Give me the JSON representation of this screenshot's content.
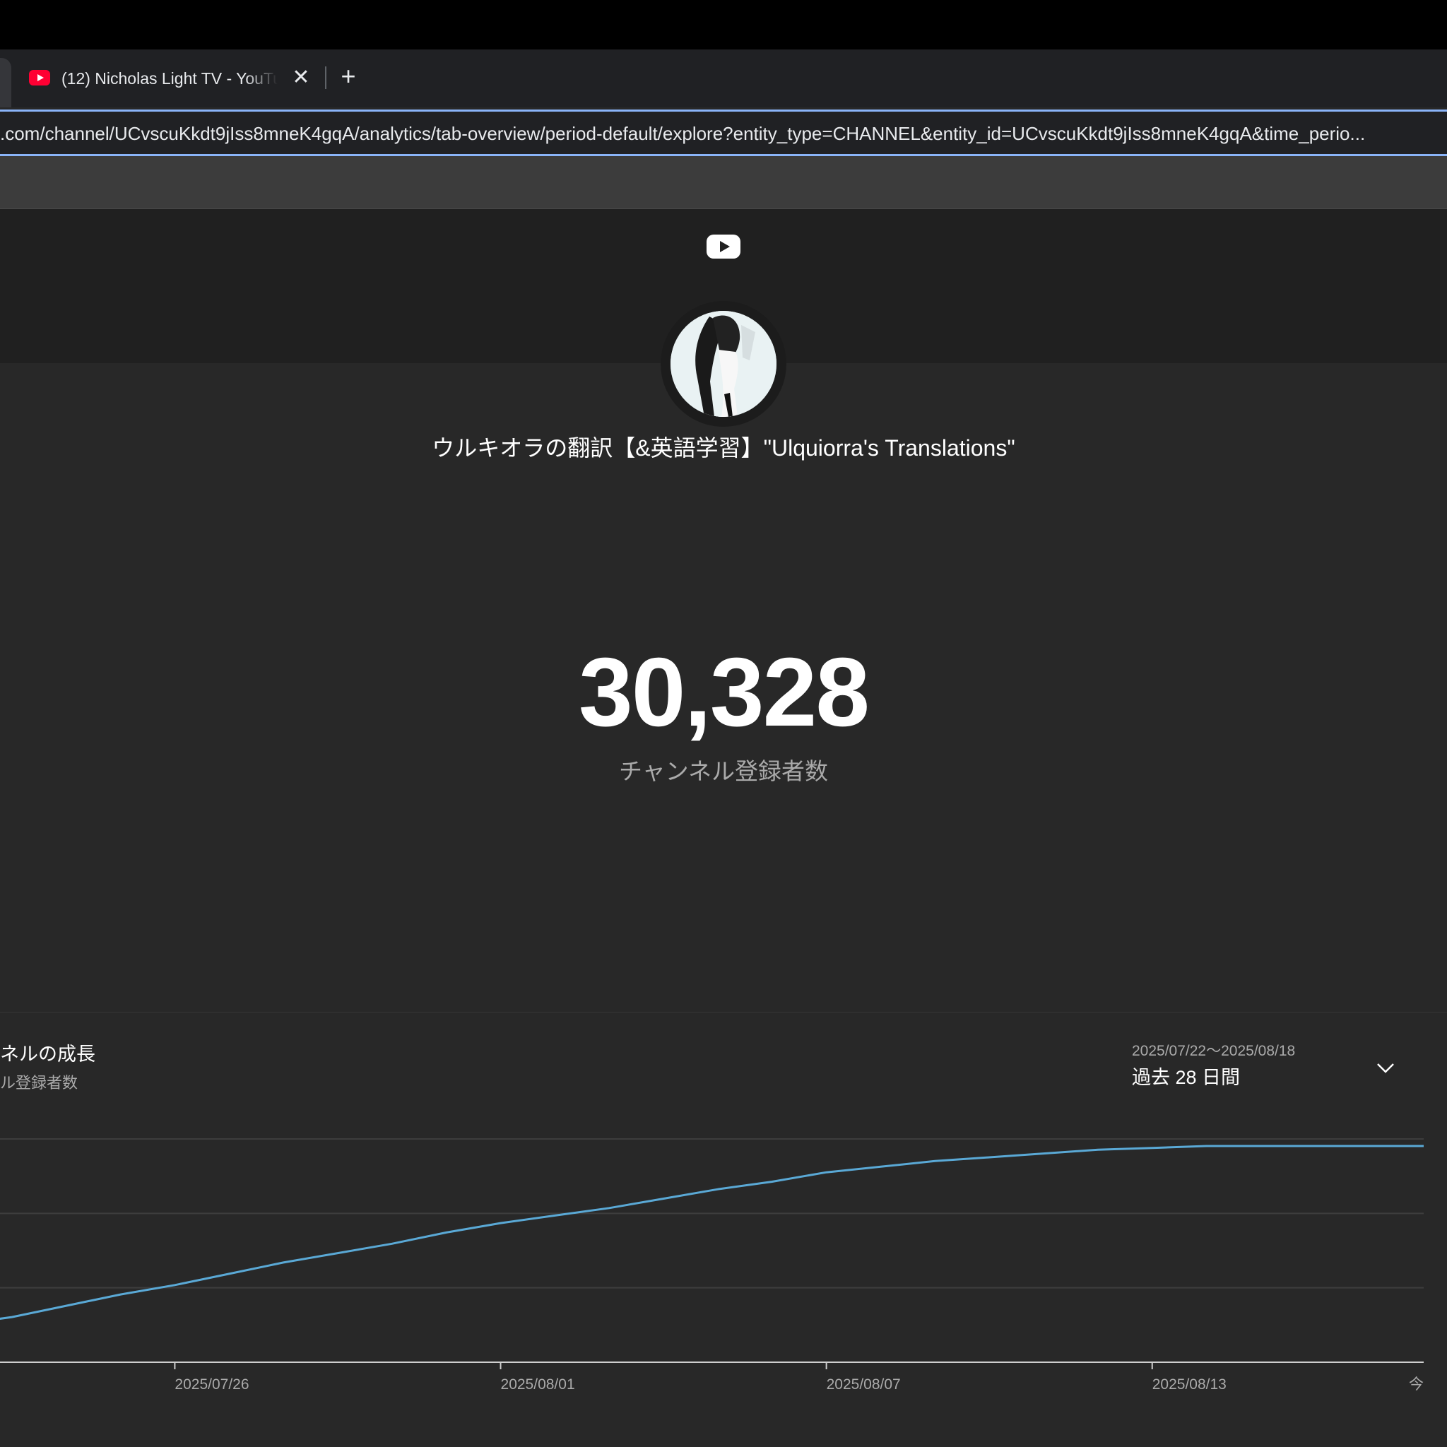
{
  "browser": {
    "tab_title": "(12) Nicholas Light TV - YouTube",
    "close_glyph": "✕",
    "new_tab_glyph": "+",
    "url": ".com/channel/UCvscuKkdt9jIss8mneK4gqA/analytics/tab-overview/period-default/explore?entity_type=CHANNEL&entity_id=UCvscuKkdt9jIss8mneK4gqA&time_perio..."
  },
  "channel": {
    "name": "ウルキオラの翻訳【&英語学習】\"Ulquiorra's Translations\"",
    "subscriber_count": "30,328",
    "subscriber_label": "チャンネル登録者数"
  },
  "growth": {
    "title": "ネルの成長",
    "subtitle": "ル登録者数",
    "date_range": "2025/07/22〜2025/08/18",
    "period_label": "過去 28 日間"
  },
  "icons": {
    "youtube": "youtube-logo-icon",
    "favicon": "youtube-favicon-icon",
    "chevron": "chevron-down-icon"
  },
  "colors": {
    "line": "#5aa9d6",
    "accent_focus": "#8ab4f8"
  },
  "chart_data": {
    "type": "line",
    "x_tick_labels": [
      "2025/07/26",
      "2025/08/01",
      "2025/08/07",
      "2025/08/13",
      "今"
    ],
    "series": [
      {
        "x": [
          "2025/07/22",
          "2025/07/23",
          "2025/07/24",
          "2025/07/25",
          "2025/07/26",
          "2025/07/27",
          "2025/07/28",
          "2025/07/29",
          "2025/07/30",
          "2025/07/31",
          "2025/08/01",
          "2025/08/02",
          "2025/08/03",
          "2025/08/04",
          "2025/08/05",
          "2025/08/06",
          "2025/08/07",
          "2025/08/08",
          "2025/08/09",
          "2025/08/10",
          "2025/08/11",
          "2025/08/12",
          "2025/08/13",
          "2025/08/14",
          "2025/08/15",
          "2025/08/16",
          "2025/08/17",
          "2025/08/18"
        ],
        "values": [
          0.05,
          0.09,
          0.15,
          0.21,
          0.26,
          0.32,
          0.38,
          0.43,
          0.48,
          0.54,
          0.59,
          0.63,
          0.67,
          0.72,
          0.77,
          0.81,
          0.86,
          0.89,
          0.92,
          0.94,
          0.96,
          0.98,
          0.99,
          1.0,
          1.0,
          1.0,
          1.0,
          1.0
        ]
      }
    ],
    "grid": true,
    "legend": "none"
  }
}
